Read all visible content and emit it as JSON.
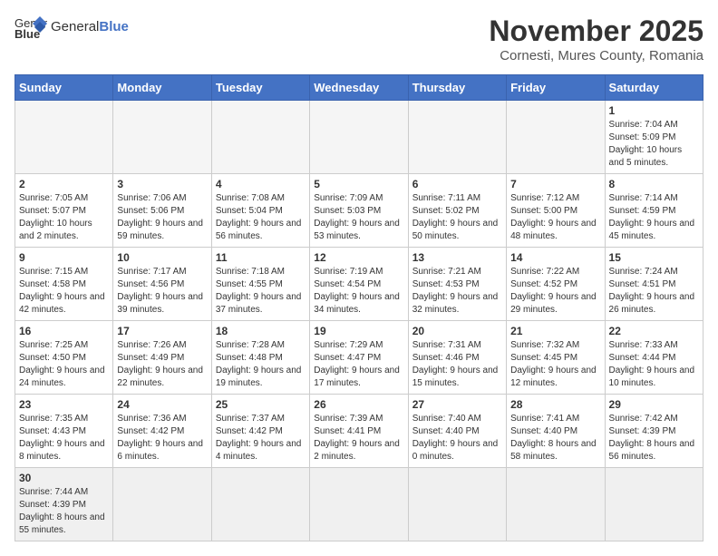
{
  "header": {
    "logo_text_regular": "General",
    "logo_text_bold": "Blue",
    "month_title": "November 2025",
    "location": "Cornesti, Mures County, Romania"
  },
  "weekdays": [
    "Sunday",
    "Monday",
    "Tuesday",
    "Wednesday",
    "Thursday",
    "Friday",
    "Saturday"
  ],
  "weeks": [
    [
      {
        "day": "",
        "info": ""
      },
      {
        "day": "",
        "info": ""
      },
      {
        "day": "",
        "info": ""
      },
      {
        "day": "",
        "info": ""
      },
      {
        "day": "",
        "info": ""
      },
      {
        "day": "",
        "info": ""
      },
      {
        "day": "1",
        "info": "Sunrise: 7:04 AM\nSunset: 5:09 PM\nDaylight: 10 hours and 5 minutes."
      }
    ],
    [
      {
        "day": "2",
        "info": "Sunrise: 7:05 AM\nSunset: 5:07 PM\nDaylight: 10 hours and 2 minutes."
      },
      {
        "day": "3",
        "info": "Sunrise: 7:06 AM\nSunset: 5:06 PM\nDaylight: 9 hours and 59 minutes."
      },
      {
        "day": "4",
        "info": "Sunrise: 7:08 AM\nSunset: 5:04 PM\nDaylight: 9 hours and 56 minutes."
      },
      {
        "day": "5",
        "info": "Sunrise: 7:09 AM\nSunset: 5:03 PM\nDaylight: 9 hours and 53 minutes."
      },
      {
        "day": "6",
        "info": "Sunrise: 7:11 AM\nSunset: 5:02 PM\nDaylight: 9 hours and 50 minutes."
      },
      {
        "day": "7",
        "info": "Sunrise: 7:12 AM\nSunset: 5:00 PM\nDaylight: 9 hours and 48 minutes."
      },
      {
        "day": "8",
        "info": "Sunrise: 7:14 AM\nSunset: 4:59 PM\nDaylight: 9 hours and 45 minutes."
      }
    ],
    [
      {
        "day": "9",
        "info": "Sunrise: 7:15 AM\nSunset: 4:58 PM\nDaylight: 9 hours and 42 minutes."
      },
      {
        "day": "10",
        "info": "Sunrise: 7:17 AM\nSunset: 4:56 PM\nDaylight: 9 hours and 39 minutes."
      },
      {
        "day": "11",
        "info": "Sunrise: 7:18 AM\nSunset: 4:55 PM\nDaylight: 9 hours and 37 minutes."
      },
      {
        "day": "12",
        "info": "Sunrise: 7:19 AM\nSunset: 4:54 PM\nDaylight: 9 hours and 34 minutes."
      },
      {
        "day": "13",
        "info": "Sunrise: 7:21 AM\nSunset: 4:53 PM\nDaylight: 9 hours and 32 minutes."
      },
      {
        "day": "14",
        "info": "Sunrise: 7:22 AM\nSunset: 4:52 PM\nDaylight: 9 hours and 29 minutes."
      },
      {
        "day": "15",
        "info": "Sunrise: 7:24 AM\nSunset: 4:51 PM\nDaylight: 9 hours and 26 minutes."
      }
    ],
    [
      {
        "day": "16",
        "info": "Sunrise: 7:25 AM\nSunset: 4:50 PM\nDaylight: 9 hours and 24 minutes."
      },
      {
        "day": "17",
        "info": "Sunrise: 7:26 AM\nSunset: 4:49 PM\nDaylight: 9 hours and 22 minutes."
      },
      {
        "day": "18",
        "info": "Sunrise: 7:28 AM\nSunset: 4:48 PM\nDaylight: 9 hours and 19 minutes."
      },
      {
        "day": "19",
        "info": "Sunrise: 7:29 AM\nSunset: 4:47 PM\nDaylight: 9 hours and 17 minutes."
      },
      {
        "day": "20",
        "info": "Sunrise: 7:31 AM\nSunset: 4:46 PM\nDaylight: 9 hours and 15 minutes."
      },
      {
        "day": "21",
        "info": "Sunrise: 7:32 AM\nSunset: 4:45 PM\nDaylight: 9 hours and 12 minutes."
      },
      {
        "day": "22",
        "info": "Sunrise: 7:33 AM\nSunset: 4:44 PM\nDaylight: 9 hours and 10 minutes."
      }
    ],
    [
      {
        "day": "23",
        "info": "Sunrise: 7:35 AM\nSunset: 4:43 PM\nDaylight: 9 hours and 8 minutes."
      },
      {
        "day": "24",
        "info": "Sunrise: 7:36 AM\nSunset: 4:42 PM\nDaylight: 9 hours and 6 minutes."
      },
      {
        "day": "25",
        "info": "Sunrise: 7:37 AM\nSunset: 4:42 PM\nDaylight: 9 hours and 4 minutes."
      },
      {
        "day": "26",
        "info": "Sunrise: 7:39 AM\nSunset: 4:41 PM\nDaylight: 9 hours and 2 minutes."
      },
      {
        "day": "27",
        "info": "Sunrise: 7:40 AM\nSunset: 4:40 PM\nDaylight: 9 hours and 0 minutes."
      },
      {
        "day": "28",
        "info": "Sunrise: 7:41 AM\nSunset: 4:40 PM\nDaylight: 8 hours and 58 minutes."
      },
      {
        "day": "29",
        "info": "Sunrise: 7:42 AM\nSunset: 4:39 PM\nDaylight: 8 hours and 56 minutes."
      }
    ],
    [
      {
        "day": "30",
        "info": "Sunrise: 7:44 AM\nSunset: 4:39 PM\nDaylight: 8 hours and 55 minutes."
      },
      {
        "day": "",
        "info": ""
      },
      {
        "day": "",
        "info": ""
      },
      {
        "day": "",
        "info": ""
      },
      {
        "day": "",
        "info": ""
      },
      {
        "day": "",
        "info": ""
      },
      {
        "day": "",
        "info": ""
      }
    ]
  ]
}
